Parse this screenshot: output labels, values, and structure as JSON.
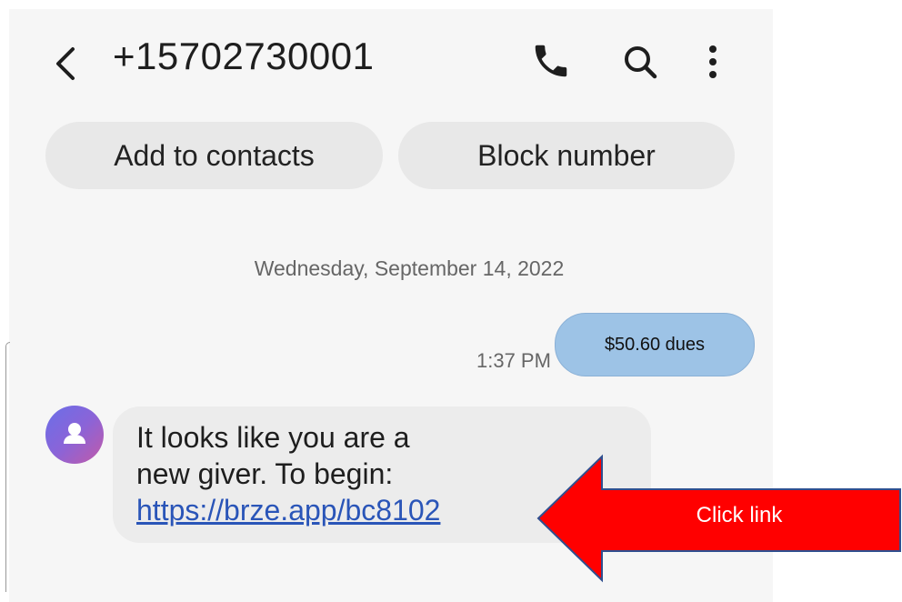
{
  "header": {
    "title": "+15702730001",
    "back_icon": "back-arrow-icon",
    "call_icon": "phone-icon",
    "search_icon": "search-icon",
    "more_icon": "more-vertical-icon"
  },
  "actions": {
    "add_contacts_label": "Add to contacts",
    "block_label": "Block number"
  },
  "conversation": {
    "date": "Wednesday, September 14, 2022",
    "sent": {
      "time": "1:37 PM",
      "text": "$50.60 dues",
      "bubble_color": "#9dc3e6"
    },
    "received": {
      "line1": "It looks like you are a",
      "line2": "new giver. To begin:",
      "link": "https://brze.app/bc8102"
    }
  },
  "annotation": {
    "label": "Click link",
    "arrow_color": "#ff0000"
  }
}
